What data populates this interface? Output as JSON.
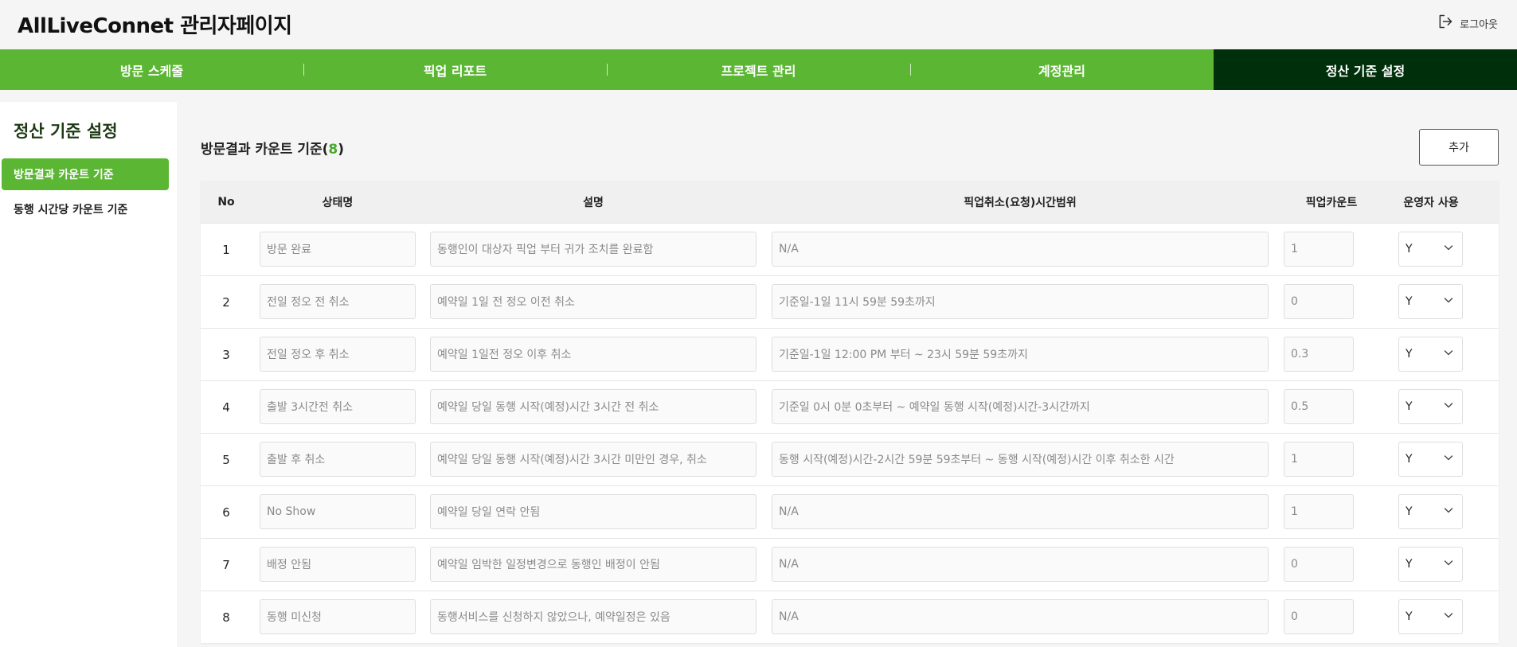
{
  "header": {
    "title": "AllLiveConnet 관리자페이지",
    "logout_label": "로그아웃"
  },
  "nav": {
    "items": [
      {
        "label": "방문 스케줄"
      },
      {
        "label": "픽업 리포트"
      },
      {
        "label": "프로젝트 관리"
      },
      {
        "label": "계정관리"
      },
      {
        "label": "정산 기준 설정"
      }
    ],
    "active_index": 4
  },
  "sidebar": {
    "title": "정산 기준 설정",
    "items": [
      {
        "label": "방문결과 카운트 기준"
      },
      {
        "label": "동행 시간당 카운트 기준"
      }
    ],
    "active_index": 0
  },
  "section": {
    "title": "방문결과 카운트 기준(",
    "count": "8",
    "close": ")",
    "add_label": "추가"
  },
  "table": {
    "headers": [
      "No",
      "상태명",
      "설명",
      "픽업취소(요청)시간범위",
      "픽업카운트",
      "운영자 사용"
    ],
    "rows": [
      {
        "no": "1",
        "status": "방문 완료",
        "desc": "동행인이 대상자 픽업 부터 귀가 조치를 완료함",
        "range": "N/A",
        "count": "1",
        "use": "Y"
      },
      {
        "no": "2",
        "status": "전일 정오 전 취소",
        "desc": "예약일 1일 전 정오 이전 취소",
        "range": "기준일-1일 11시 59분 59초까지",
        "count": "0",
        "use": "Y"
      },
      {
        "no": "3",
        "status": "전일 정오 후 취소",
        "desc": "예약일 1일전 정오 이후 취소",
        "range": "기준일-1일 12:00 PM 부터 ~ 23시 59분 59초까지",
        "count": "0.3",
        "use": "Y"
      },
      {
        "no": "4",
        "status": "출발 3시간전 취소",
        "desc": "예약일 당일 동행 시작(예정)시간 3시간 전 취소",
        "range": "기준일 0시 0분 0초부터 ~ 예약일 동행 시작(예정)시간-3시간까지",
        "count": "0.5",
        "use": "Y"
      },
      {
        "no": "5",
        "status": "출발 후 취소",
        "desc": "예약일 당일 동행 시작(예정)시간 3시간 미만인 경우, 취소",
        "range": "동행 시작(예정)시간-2시간 59분 59초부터 ~ 동행 시작(예정)시간 이후 취소한 시간",
        "count": "1",
        "use": "Y"
      },
      {
        "no": "6",
        "status": "No Show",
        "desc": "예약일 당일 연락 안됨",
        "range": "N/A",
        "count": "1",
        "use": "Y"
      },
      {
        "no": "7",
        "status": "배정 안됨",
        "desc": "예약일 임박한 일정변경으로 동행인 배정이 안됨",
        "range": "N/A",
        "count": "0",
        "use": "Y"
      },
      {
        "no": "8",
        "status": "동행 미신청",
        "desc": "동행서비스를 신청하지 않았으나, 예약일정은 있음",
        "range": "N/A",
        "count": "0",
        "use": "Y"
      }
    ]
  }
}
